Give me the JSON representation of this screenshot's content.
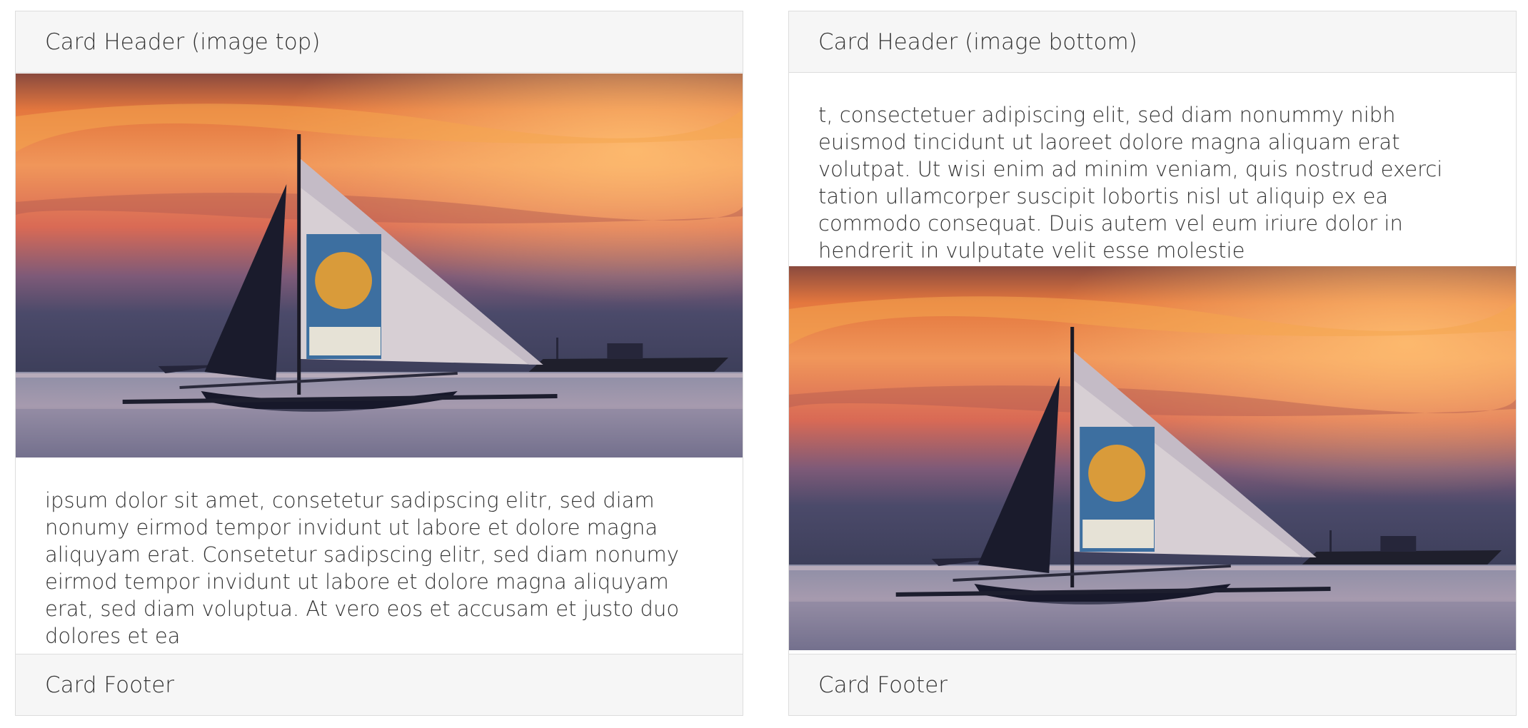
{
  "cards": [
    {
      "header": "Card Header (image top)",
      "text": "ipsum dolor sit amet, consetetur sadipscing elitr, sed diam nonumy eirmod tempor invidunt ut labore et dolore magna aliquyam erat. Consetetur sadipscing elitr, sed diam nonumy eirmod tempor invidunt ut labore et dolore magna aliquyam erat, sed diam voluptua. At vero eos et accusam et justo duo dolores et ea",
      "footer": "Card Footer"
    },
    {
      "header": "Card Header (image bottom)",
      "text": "t, consectetuer adipiscing elit, sed diam nonummy nibh euismod tincidunt ut laoreet dolore magna aliquam erat volutpat. Ut wisi enim ad minim veniam, quis nostrud exerci tation ullamcorper suscipit lobortis nisl ut aliquip ex ea commodo consequat. Duis autem vel eum iriure dolor in hendrerit in vulputate velit esse molestie",
      "footer": "Card Footer"
    }
  ],
  "colors": {
    "header_bg": "#f6f6f6",
    "border": "#dddddd",
    "text": "#333333"
  }
}
